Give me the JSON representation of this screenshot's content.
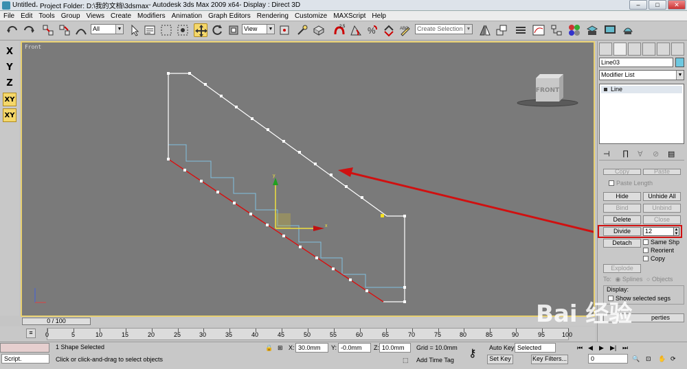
{
  "title": {
    "doc": "Untitled",
    "project": " - Project Folder: D:\\我的文档\\3dsmax",
    "app": " - Autodesk 3ds Max  2009 x64",
    "display": "   - Display : Direct 3D"
  },
  "menu": [
    "File",
    "Edit",
    "Tools",
    "Group",
    "Views",
    "Create",
    "Modifiers",
    "Animation",
    "Graph Editors",
    "Rendering",
    "Customize",
    "MAXScript",
    "Help"
  ],
  "toolbar": {
    "filter": "All",
    "refcoord": "View",
    "named_sel_placeholder": "Create Selection Set"
  },
  "left_axis": [
    "X",
    "Y",
    "Z",
    "XY",
    "XY"
  ],
  "viewport": {
    "label": "Front",
    "viewcube_label": "FRONT",
    "gizmo_x": "x",
    "gizmo_y": "y"
  },
  "command_panel": {
    "object_name": "Line03",
    "object_color": "#6ec8e0",
    "modifier_list": "Modifier List",
    "stack_item": "Line",
    "buttons": {
      "copy": "Copy",
      "paste": "Paste",
      "paste_length": "Paste Length",
      "hide": "Hide",
      "unhide_all": "Unhide All",
      "bind": "Bind",
      "unbind": "Unbind",
      "delete": "Delete",
      "close": "Close",
      "divide": "Divide",
      "detach": "Detach",
      "explode": "Explode"
    },
    "divide_value": "12",
    "checks": {
      "same_shp": "Same Shp",
      "reorient": "Reorient",
      "copy": "Copy"
    },
    "to_label": "To:",
    "splines": "Splines",
    "objects": "Objects",
    "display_group": "Display:",
    "show_selected_segs": "Show selected segs",
    "properties_label": "perties"
  },
  "time": {
    "slider": "0 / 100",
    "ticks": [
      "0",
      "5",
      "10",
      "15",
      "20",
      "25",
      "30",
      "35",
      "40",
      "45",
      "50",
      "55",
      "60",
      "65",
      "70",
      "75",
      "80",
      "85",
      "90",
      "95",
      "100"
    ]
  },
  "status": {
    "script_label": "Script.",
    "selection": "1 Shape Selected",
    "prompt": "Click or click-and-drag to select objects",
    "x_label": "X:",
    "x_val": "30.0mm",
    "y_label": "Y:",
    "y_val": "-0.0mm",
    "z_label": "Z:",
    "z_val": "10.0mm",
    "grid": "Grid = 10.0mm",
    "add_time_tag": "Add Time Tag",
    "auto_key": "Auto Key",
    "set_key": "Set Key",
    "selected": "Selected",
    "key_filters": "Key Filters...",
    "frame": "0"
  },
  "watermark": "Bai 经验",
  "colors": {
    "accent": "#f4d76a",
    "highlight": "#d01010",
    "spline": "#ffffff",
    "stair": "#80c0e0"
  }
}
